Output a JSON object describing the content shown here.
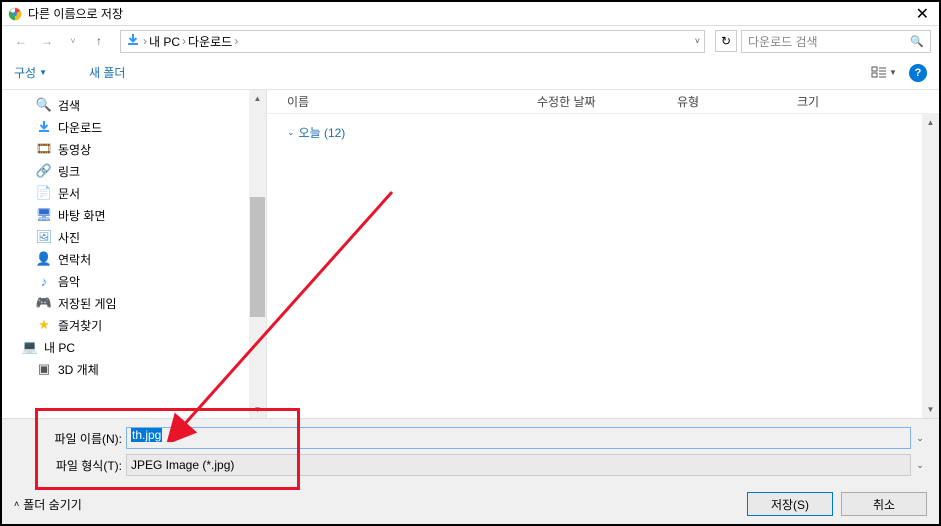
{
  "title": "다른 이름으로 저장",
  "breadcrumb": {
    "a": "내 PC",
    "b": "다운로드"
  },
  "search_placeholder": "다운로드 검색",
  "toolbar": {
    "organize": "구성",
    "newfolder": "새 폴더"
  },
  "tree": {
    "search": "검색",
    "downloads": "다운로드",
    "videos": "동영상",
    "links": "링크",
    "documents": "문서",
    "desktop": "바탕 화면",
    "pictures": "사진",
    "contacts": "연락처",
    "music": "음악",
    "savedgames": "저장된 게임",
    "favorites": "즐겨찾기",
    "thispc": "내 PC",
    "threed": "3D 개체"
  },
  "columns": {
    "name": "이름",
    "date": "수정한 날짜",
    "type": "유형",
    "size": "크기"
  },
  "group_today": "오늘 (12)",
  "fields": {
    "name_label": "파일 이름(N):",
    "name_value": "th.jpg",
    "type_label": "파일 형식(T):",
    "type_value": "JPEG Image (*.jpg)"
  },
  "footer": {
    "hide": "폴더 숨기기",
    "save": "저장(S)",
    "cancel": "취소"
  }
}
